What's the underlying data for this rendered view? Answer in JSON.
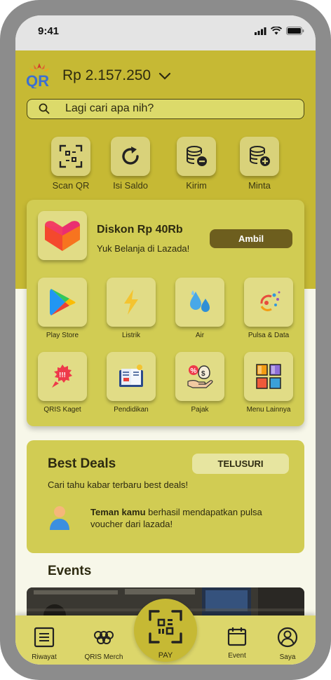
{
  "status_bar": {
    "time": "9:41"
  },
  "header": {
    "balance": "Rp 2.157.250"
  },
  "search": {
    "placeholder": "Lagi cari apa nih?"
  },
  "quick_actions": [
    {
      "label": "Scan QR",
      "icon": "scan-icon"
    },
    {
      "label": "Isi Saldo",
      "icon": "refresh-icon"
    },
    {
      "label": "Kirim",
      "icon": "coins-minus-icon"
    },
    {
      "label": "Minta",
      "icon": "coins-plus-icon"
    }
  ],
  "promo": {
    "title": "Diskon Rp 40Rb",
    "subtitle": "Yuk Belanja di Lazada!",
    "cta": "Ambil"
  },
  "services": [
    {
      "label": "Play Store",
      "icon": "play-store-icon"
    },
    {
      "label": "Listrik",
      "icon": "lightning-icon"
    },
    {
      "label": "Air",
      "icon": "water-drops-icon"
    },
    {
      "label": "Pulsa & Data",
      "icon": "signal-icon"
    },
    {
      "label": "QRIS Kaget",
      "icon": "megaphone-icon"
    },
    {
      "label": "Pendidikan",
      "icon": "book-icon"
    },
    {
      "label": "Pajak",
      "icon": "tax-hand-icon"
    },
    {
      "label": "Menu Lainnya",
      "icon": "grid-icon"
    }
  ],
  "best_deals": {
    "title": "Best Deals",
    "cta": "TELUSURI",
    "subtitle": "Cari tahu kabar terbaru best deals!",
    "message_bold": "Teman kamu",
    "message_rest": " berhasil mendapatkan pulsa voucher dari lazada!"
  },
  "events": {
    "title": "Events"
  },
  "bottom_nav": {
    "riwayat": "Riwayat",
    "merch": "QRIS Merch",
    "pay": "PAY",
    "event": "Event",
    "saya": "Saya"
  },
  "colors": {
    "header_bg": "#c6b934",
    "card_bg": "#d1cc53",
    "button_dark": "#6d5e1e",
    "page_bg": "#f7f7e9"
  }
}
